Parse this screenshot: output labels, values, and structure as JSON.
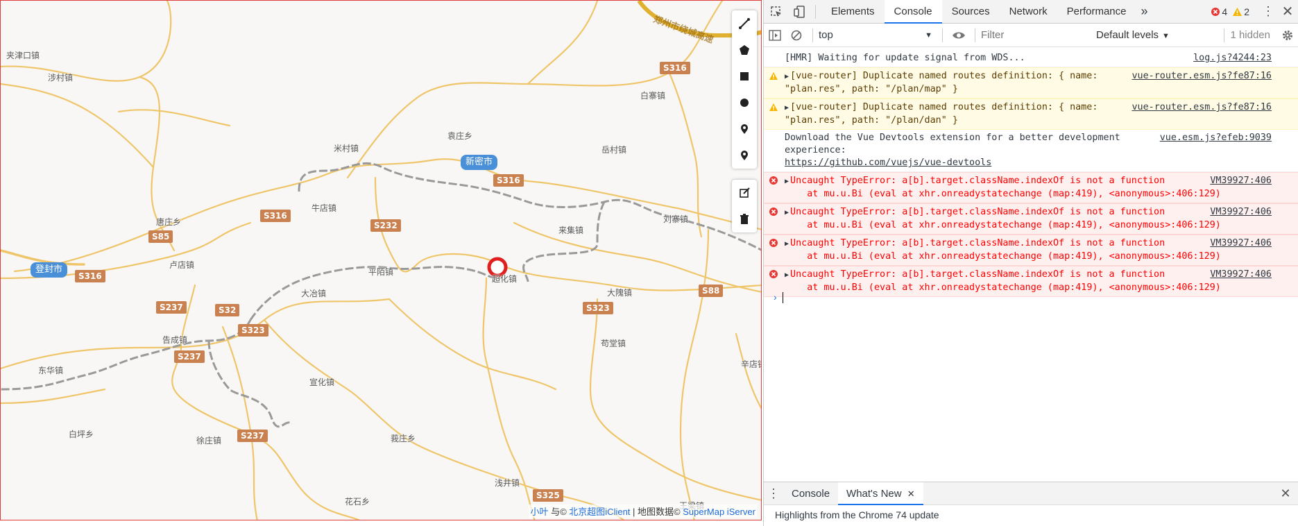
{
  "map": {
    "places": [
      {
        "name": "夹津口镇"
      },
      {
        "name": "涉村镇"
      },
      {
        "name": "袁庄乡"
      },
      {
        "name": "米村镇"
      },
      {
        "name": "岳村镇"
      },
      {
        "name": "白寨镇"
      },
      {
        "name": "牛店镇"
      },
      {
        "name": "唐庄乡"
      },
      {
        "name": "来集镇"
      },
      {
        "name": "刘寨镇"
      },
      {
        "name": "卢店镇"
      },
      {
        "name": "平陌镇"
      },
      {
        "name": "超化镇"
      },
      {
        "name": "大冶镇"
      },
      {
        "name": "大隗镇"
      },
      {
        "name": "告成镇"
      },
      {
        "name": "苟堂镇"
      },
      {
        "name": "东华镇"
      },
      {
        "name": "宣化镇"
      },
      {
        "name": "辛店镇"
      },
      {
        "name": "白坪乡"
      },
      {
        "name": "徐庄镇"
      },
      {
        "name": "莪庄乡"
      },
      {
        "name": "浅井镇"
      },
      {
        "name": "花石乡"
      },
      {
        "name": "王梁镇"
      }
    ],
    "cities": [
      {
        "name": "新密市"
      },
      {
        "name": "登封市"
      }
    ],
    "shields": [
      "S316",
      "S316",
      "S316",
      "S232",
      "S85",
      "S316",
      "S237",
      "S32",
      "S323",
      "S237",
      "S323",
      "S88",
      "S237",
      "S325"
    ],
    "highway_label": "郑州市绕城高速",
    "attribution": {
      "author": "小叶",
      "with": " 与© ",
      "bj": "北京超图iClient",
      "sep": " | 地图数据© ",
      "sm": "SuperMap iServer"
    },
    "tools": [
      "line-tool-icon",
      "polygon-tool-icon",
      "rectangle-tool-icon",
      "circle-tool-icon",
      "marker-tool-icon",
      "marker-tool-icon",
      "edit-icon",
      "trash-icon"
    ]
  },
  "devtools": {
    "tabs": [
      "Elements",
      "Console",
      "Sources",
      "Network",
      "Performance"
    ],
    "active_tab": "Console",
    "error_count": "4",
    "warning_count": "2",
    "context": "top",
    "filter_placeholder": "Filter",
    "levels": "Default levels",
    "hidden": "1 hidden",
    "messages": [
      {
        "level": "log",
        "lines": [
          "[HMR] Waiting for update signal from WDS..."
        ],
        "src": "log.js?4244:23"
      },
      {
        "level": "warn",
        "lines": [
          "[vue-router] Duplicate named routes definition: { name:",
          "\"plan.res\", path: \"/plan/map\" }"
        ],
        "src": "vue-router.esm.js?fe87:16"
      },
      {
        "level": "warn",
        "lines": [
          "[vue-router] Duplicate named routes definition: { name:",
          "\"plan.res\", path: \"/plan/dan\" }"
        ],
        "src": "vue-router.esm.js?fe87:16"
      },
      {
        "level": "log",
        "lines": [
          "Download the Vue Devtools extension for a better development",
          "experience:",
          "https://github.com/vuejs/vue-devtools"
        ],
        "src": "vue.esm.js?efeb:9039"
      },
      {
        "level": "error",
        "lines": [
          "Uncaught TypeError: a[b].target.className.indexOf is not a function",
          "    at mu.u.Bi (eval at xhr.onreadystatechange (map:419), <anonymous>:406:129)"
        ],
        "src": "VM39927:406"
      },
      {
        "level": "error",
        "lines": [
          "Uncaught TypeError: a[b].target.className.indexOf is not a function",
          "    at mu.u.Bi (eval at xhr.onreadystatechange (map:419), <anonymous>:406:129)"
        ],
        "src": "VM39927:406"
      },
      {
        "level": "error",
        "lines": [
          "Uncaught TypeError: a[b].target.className.indexOf is not a function",
          "    at mu.u.Bi (eval at xhr.onreadystatechange (map:419), <anonymous>:406:129)"
        ],
        "src": "VM39927:406"
      },
      {
        "level": "error",
        "lines": [
          "Uncaught TypeError: a[b].target.className.indexOf is not a function",
          "    at mu.u.Bi (eval at xhr.onreadystatechange (map:419), <anonymous>:406:129)"
        ],
        "src": "VM39927:406"
      }
    ],
    "drawer_tabs": [
      "Console",
      "What's New"
    ],
    "drawer_active": "What's New",
    "drawer_text": "Highlights from the Chrome 74 update"
  },
  "colors": {
    "road": "#f0c86a",
    "rail": "#9a9a9a",
    "shield": "#c9814f",
    "city": "#4a90d9",
    "marker": "#e02020"
  }
}
